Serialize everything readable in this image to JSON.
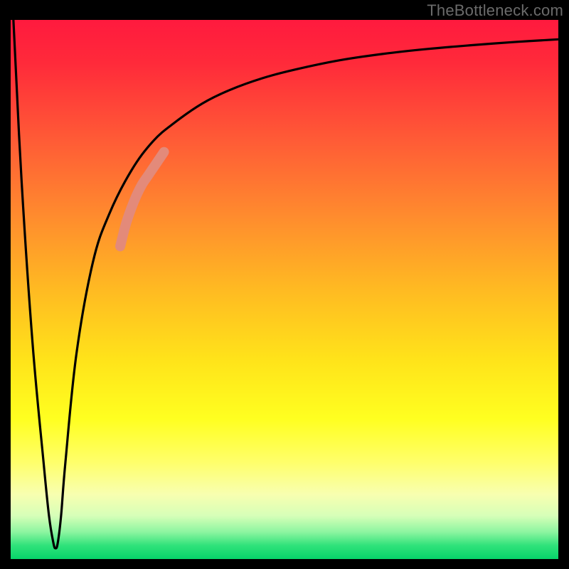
{
  "watermark": "TheBottleneck.com",
  "chart_data": {
    "type": "line",
    "title": "",
    "xlabel": "",
    "ylabel": "",
    "xlim": [
      0,
      100
    ],
    "ylim": [
      0,
      100
    ],
    "grid": false,
    "legend": false,
    "gradient_stops": [
      {
        "pos": 0,
        "color": "#ff1a3e"
      },
      {
        "pos": 8,
        "color": "#ff2a3a"
      },
      {
        "pos": 22,
        "color": "#ff5a36"
      },
      {
        "pos": 36,
        "color": "#ff8a2e"
      },
      {
        "pos": 50,
        "color": "#ffba22"
      },
      {
        "pos": 63,
        "color": "#ffe31a"
      },
      {
        "pos": 74,
        "color": "#ffff20"
      },
      {
        "pos": 82,
        "color": "#ffff6a"
      },
      {
        "pos": 88,
        "color": "#f8ffb0"
      },
      {
        "pos": 92,
        "color": "#d6ffb8"
      },
      {
        "pos": 95,
        "color": "#8cf5a0"
      },
      {
        "pos": 97.5,
        "color": "#2fe27a"
      },
      {
        "pos": 100,
        "color": "#07d46a"
      }
    ],
    "series": [
      {
        "name": "bottleneck-curve",
        "color": "#000000",
        "x": [
          0.5,
          2,
          4,
          6,
          7,
          7.8,
          8.2,
          8.6,
          9.2,
          10,
          12,
          15,
          18,
          22,
          26,
          30,
          35,
          40,
          46,
          52,
          60,
          68,
          76,
          84,
          92,
          100
        ],
        "y": [
          100,
          70,
          40,
          18,
          8,
          3,
          2,
          3,
          8,
          18,
          38,
          55,
          64,
          72,
          77.5,
          81,
          84.5,
          87,
          89.2,
          90.8,
          92.5,
          93.7,
          94.6,
          95.3,
          95.9,
          96.4
        ]
      },
      {
        "name": "highlight-segment",
        "color": "#e38a7a",
        "x": [
          20,
          21,
          22,
          23,
          24,
          25,
          26,
          27,
          28
        ],
        "y": [
          58,
          62,
          65,
          67.5,
          69.5,
          71,
          72.5,
          74,
          75.5
        ]
      }
    ]
  }
}
